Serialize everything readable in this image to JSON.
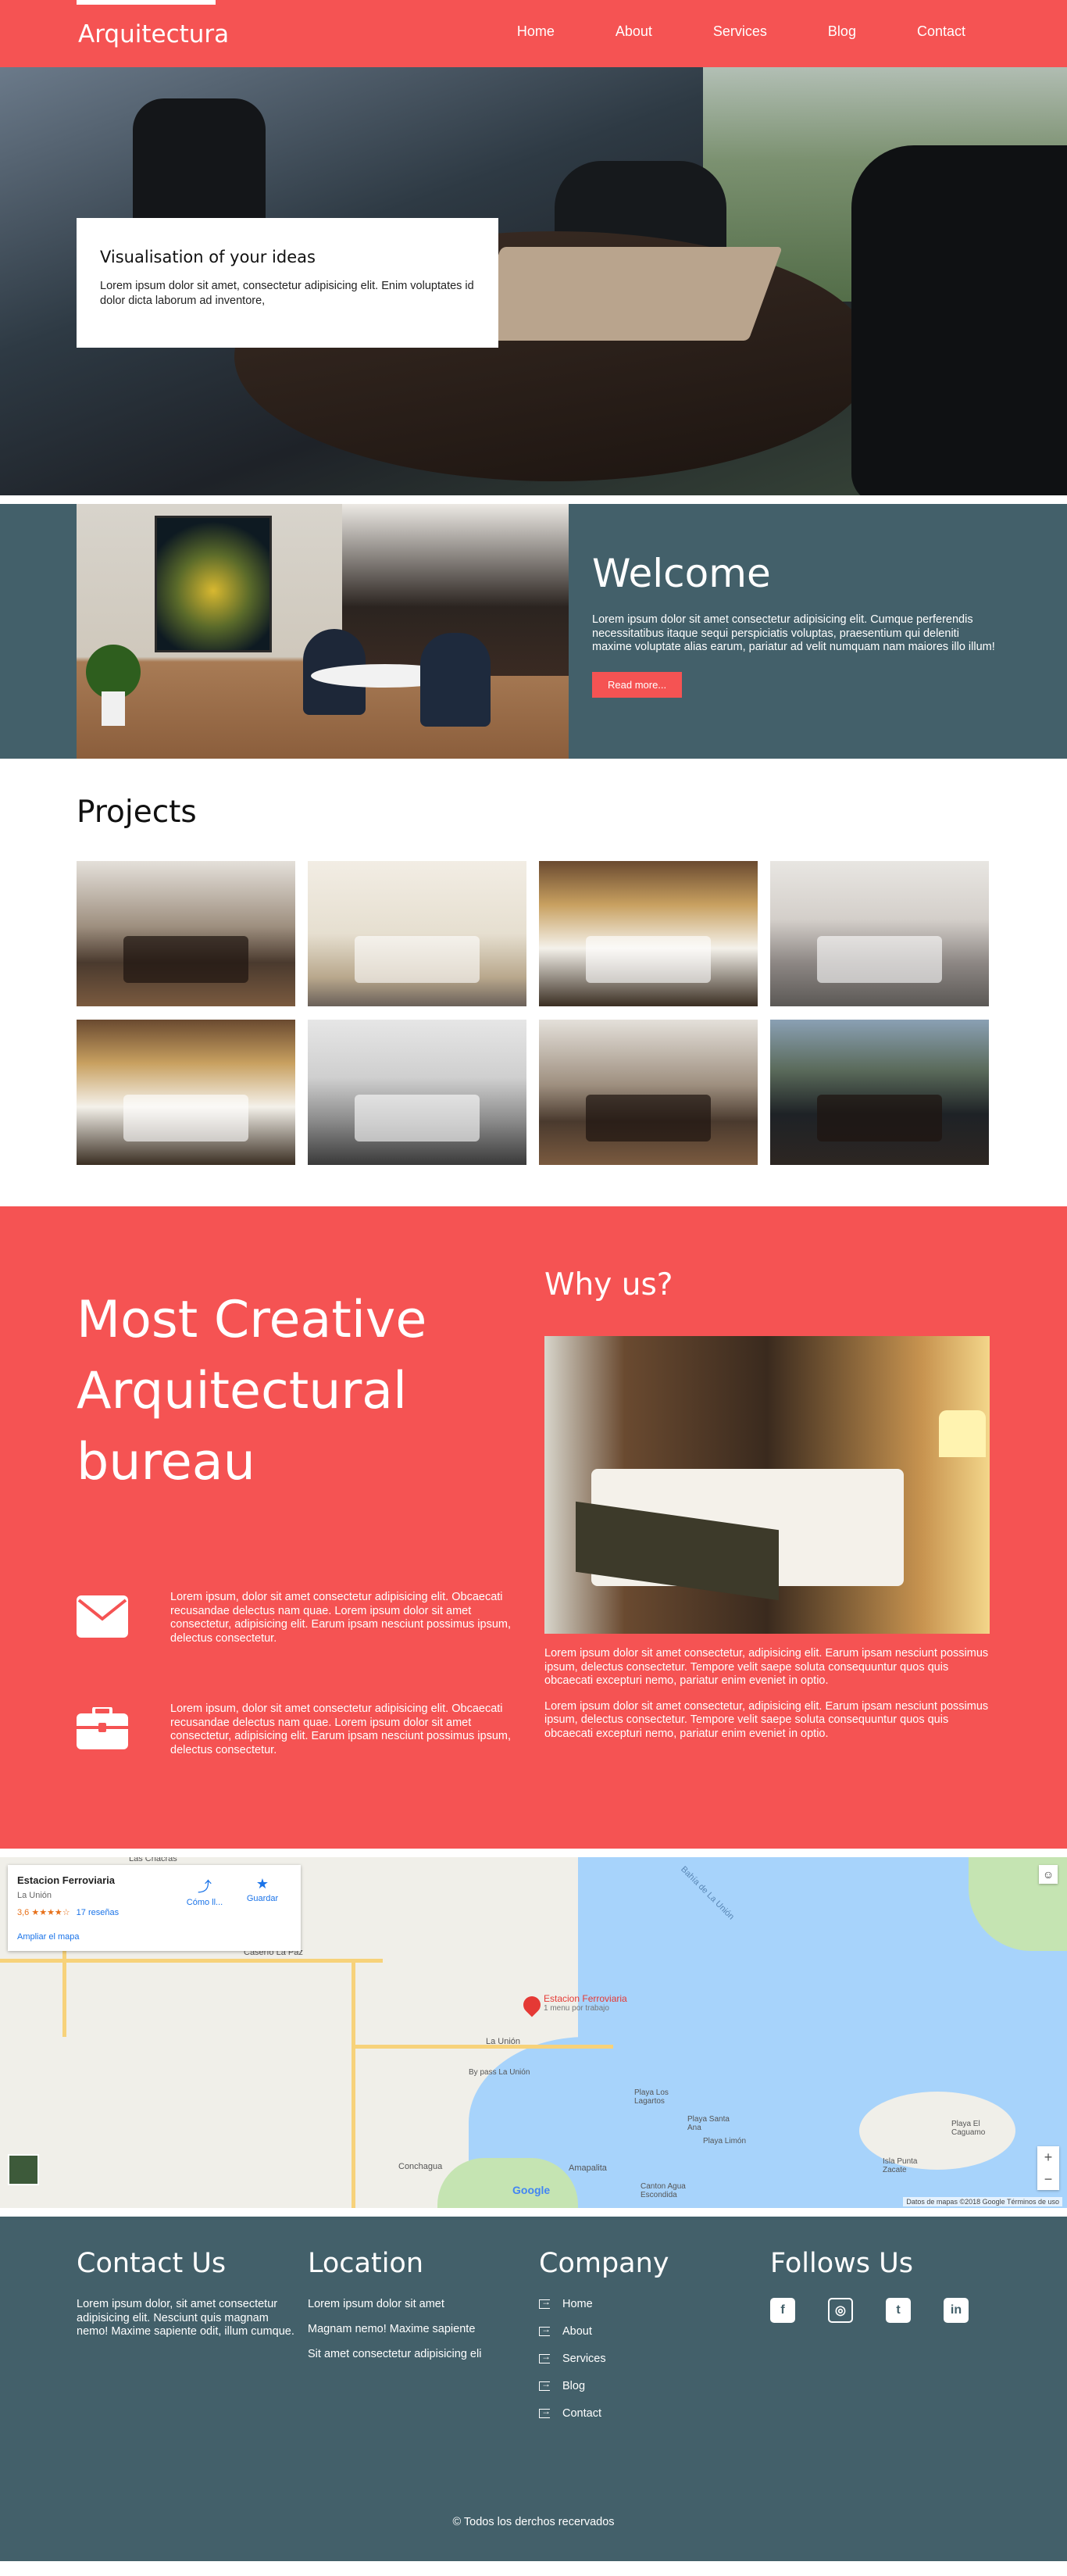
{
  "nav": {
    "brand": "Arquitectura",
    "items": [
      "Home",
      "About",
      "Services",
      "Blog",
      "Contact"
    ]
  },
  "hero": {
    "title": "Visualisation of your ideas",
    "text": "Lorem ipsum dolor sit amet, consectetur adipisicing elit. Enim voluptates id dolor dicta laborum ad inventore,"
  },
  "welcome": {
    "title": "Welcome",
    "text": "Lorem ipsum dolor sit amet consectetur adipisicing elit. Cumque perferendis necessitatibus itaque sequi perspiciatis voluptas, praesentium qui deleniti maxime voluptate alias earum, pariatur ad velit numquam nam maiores illo illum!",
    "button": "Read more..."
  },
  "projects": {
    "title": "Projects",
    "items": [
      "dining-room",
      "white-bedroom",
      "hotel-bedroom",
      "living-room",
      "hotel-bedroom-2",
      "bright-living-room",
      "dining-room-2",
      "office"
    ]
  },
  "creative": {
    "title": "Most Creative Arquitectural bureau",
    "features": [
      {
        "icon": "envelope-icon",
        "text": "Lorem ipsum, dolor sit amet consectetur adipisicing elit. Obcaecati recusandae delectus nam quae. Lorem ipsum dolor sit amet consectetur, adipisicing elit. Earum ipsam nesciunt possimus ipsum, delectus consectetur."
      },
      {
        "icon": "briefcase-icon",
        "text": "Lorem ipsum, dolor sit amet consectetur adipisicing elit. Obcaecati recusandae delectus nam quae. Lorem ipsum dolor sit amet consectetur, adipisicing elit. Earum ipsam nesciunt possimus ipsum, delectus consectetur."
      }
    ],
    "why_title": "Why us?",
    "why_paragraphs": [
      "Lorem ipsum dolor sit amet consectetur, adipisicing elit. Earum ipsam nesciunt possimus ipsum, delectus consectetur. Tempore velit saepe soluta consequuntur quos quis obcaecati excepturi nemo, pariatur enim eveniet in optio.",
      "Lorem ipsum dolor sit amet consectetur, adipisicing elit. Earum ipsam nesciunt possimus ipsum, delectus consectetur. Tempore velit saepe soluta consequuntur quos quis obcaecati excepturi nemo, pariatur enim eveniet in optio."
    ]
  },
  "map": {
    "place": "Estacion Ferroviaria",
    "locality": "La Unión",
    "rating": "3,6 ★★★★☆",
    "reviews": "17 reseñas",
    "directions": "Cómo ll...",
    "save": "Guardar",
    "enlarge": "Ampliar el mapa",
    "pin_label": "Estacion Ferroviaria",
    "pin_sub": "1 menu por trabajo",
    "labels": [
      "Las Chacras",
      "Caserío La Paz",
      "La Unión",
      "By pass La Unión",
      "Playa Los Lagartos",
      "Playa Santa Ana",
      "Playa Limón",
      "Isla Punta Zacate",
      "Playa El Caguamo",
      "Conchagua",
      "Amapalita",
      "Canton Agua Escondida",
      "Bahía de La Unión"
    ],
    "google": "Google",
    "terms": "Datos de mapas ©2018 Google   Términos de uso"
  },
  "footer": {
    "contact_title": "Contact Us",
    "contact_text": "Lorem ipsum dolor, sit amet consectetur adipisicing elit. Nesciunt quis magnam nemo! Maxime sapiente odit, illum cumque.",
    "location_title": "Location",
    "location_lines": [
      "Lorem ipsum dolor sit amet",
      "Magnam nemo! Maxime sapiente",
      "Sit amet consectetur adipisicing eli"
    ],
    "company_title": "Company",
    "company_links": [
      "Home",
      "About",
      "Services",
      "Blog",
      "Contact"
    ],
    "follow_title": "Follows Us",
    "socials": [
      "facebook-icon",
      "instagram-icon",
      "twitter-icon",
      "linkedin-icon"
    ],
    "copyright": "© Todos los derchos recervados"
  }
}
